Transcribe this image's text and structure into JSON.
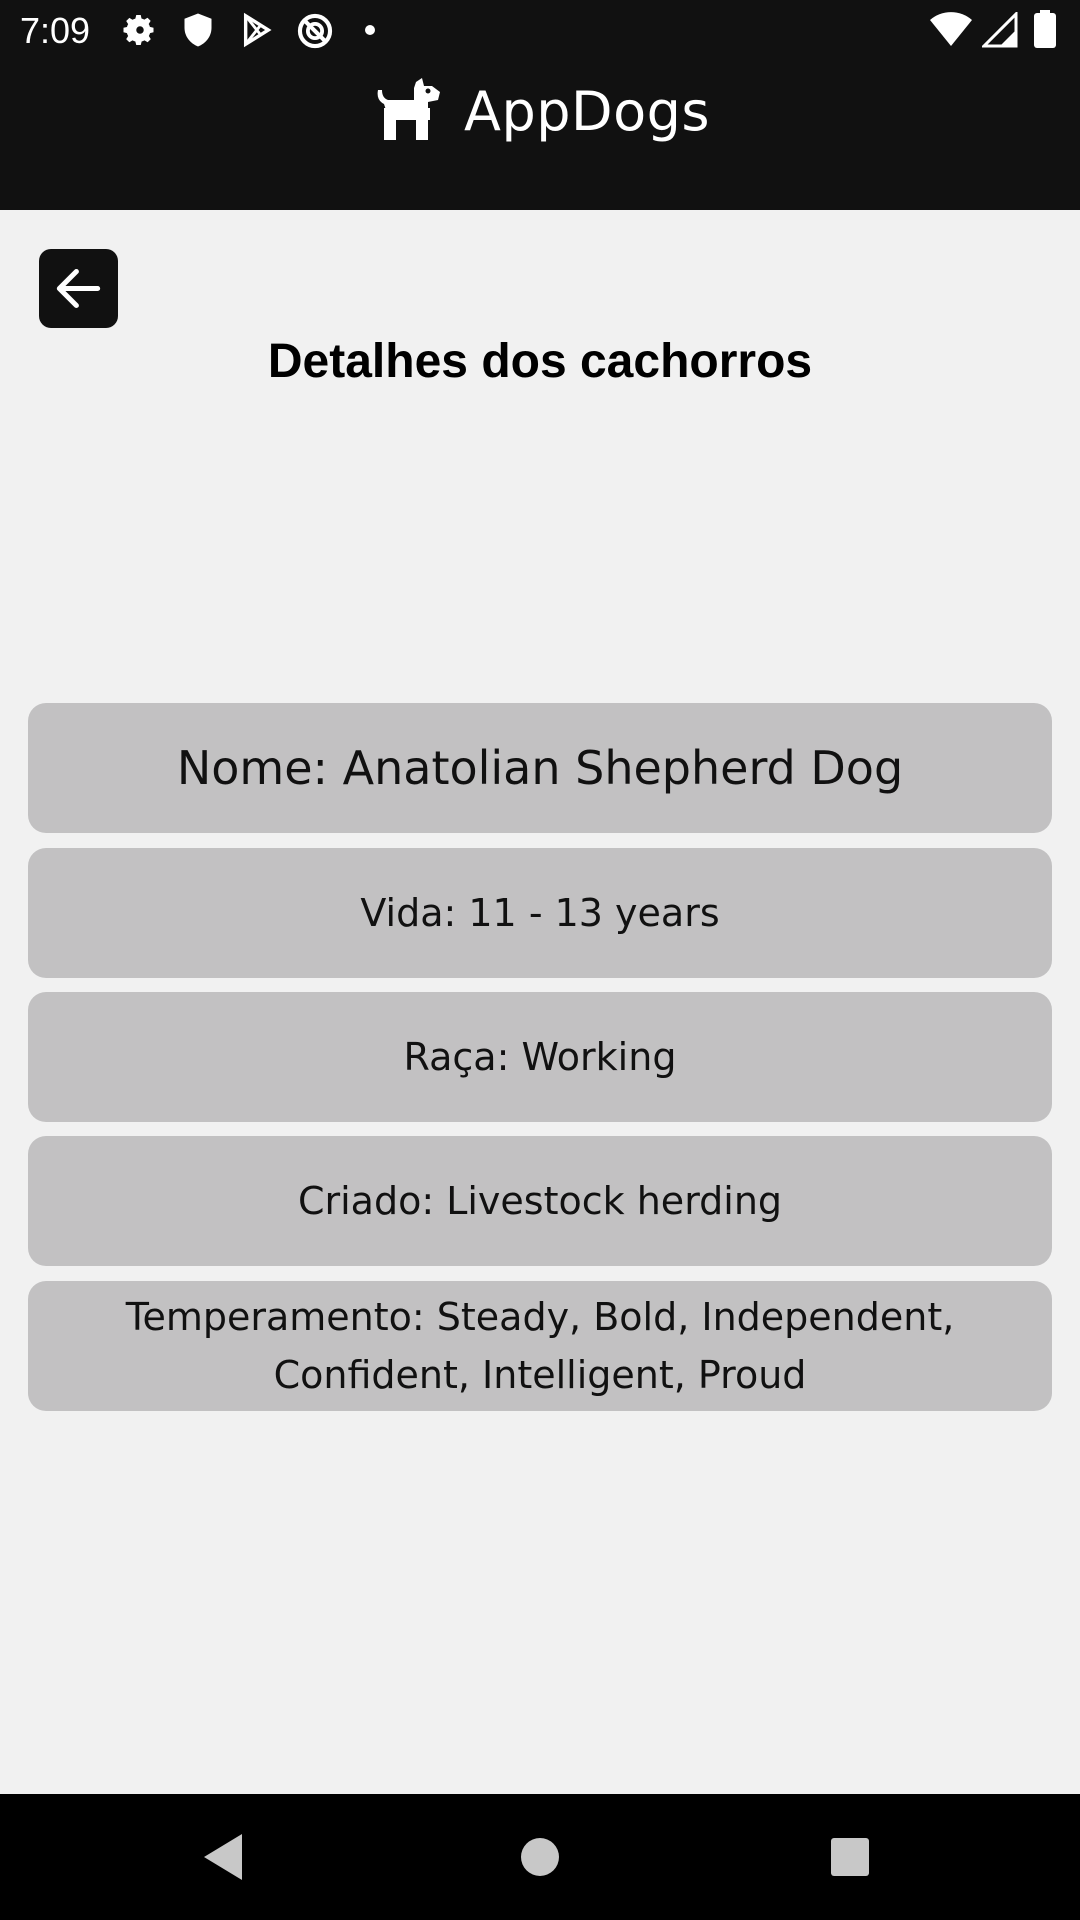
{
  "status_bar": {
    "time": "7:09",
    "left_icons": [
      "settings-icon",
      "shield-icon",
      "play-store-icon",
      "vpn-icon",
      "dot-icon"
    ],
    "right_icons": [
      "wifi-icon",
      "signal-icon",
      "battery-icon"
    ]
  },
  "app_bar": {
    "title": "AppDogs",
    "icon": "dog-icon"
  },
  "page": {
    "back_icon": "arrow-left-icon",
    "title": "Detalhes dos cachorros"
  },
  "details": {
    "name": "Nome: Anatolian Shepherd Dog",
    "life_span": "Vida: 11 - 13 years",
    "breed_group": "Raça: Working",
    "bred_for": "Criado: Livestock herding",
    "temperament": "Temperamento: Steady, Bold, Independent, Confident, Intelligent, Proud"
  },
  "nav_bar": {
    "icons": [
      "nav-back-icon",
      "nav-home-icon",
      "nav-recents-icon"
    ]
  },
  "colors": {
    "bar_bg": "#111111",
    "page_bg": "#f1f1f1",
    "card_bg": "#c2c1c2"
  }
}
